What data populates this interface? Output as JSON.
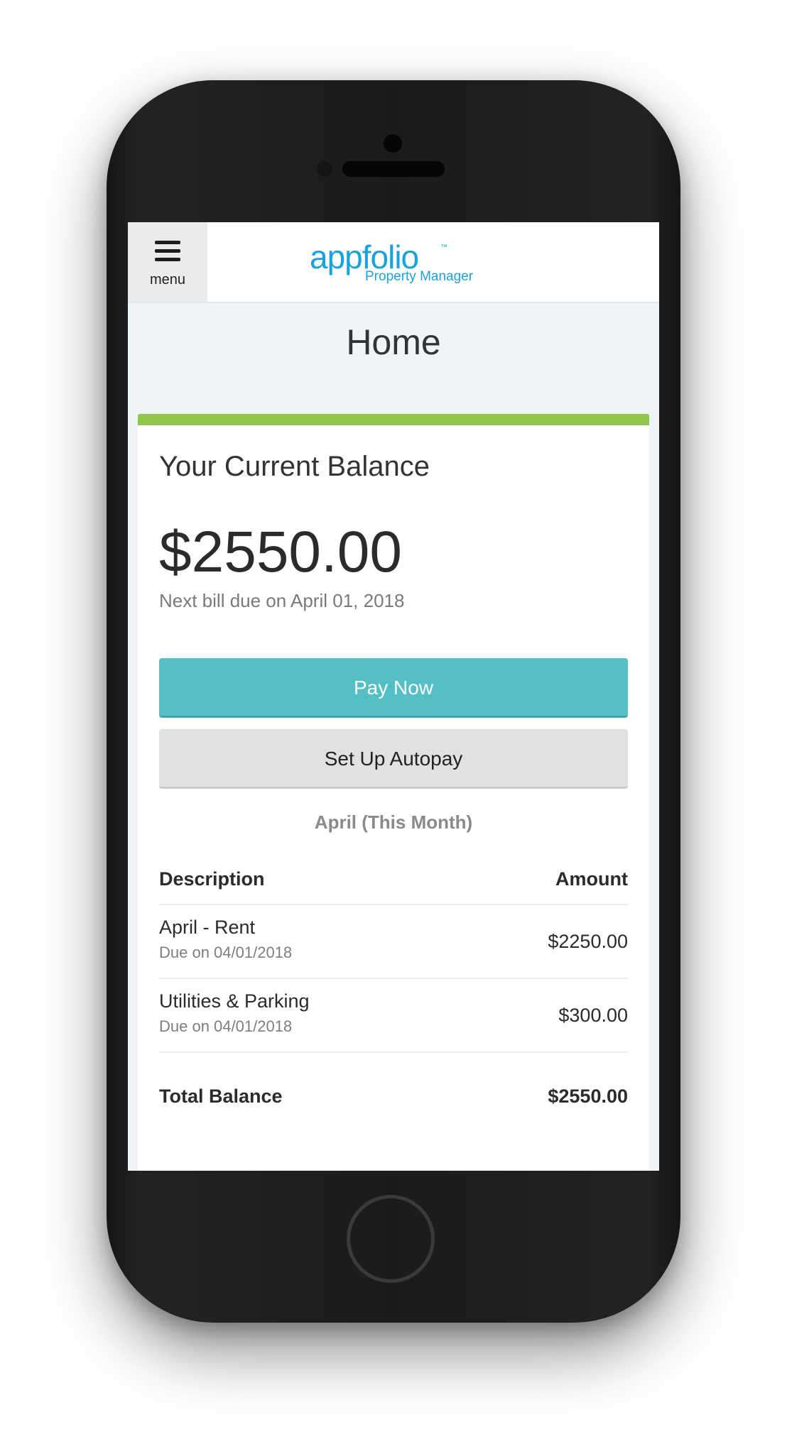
{
  "header": {
    "menu_label": "menu",
    "logo_text": "appfolio",
    "logo_tm": "™",
    "logo_subtitle": "Property Manager"
  },
  "page": {
    "title": "Home"
  },
  "balance": {
    "label": "Your Current Balance",
    "amount": "$2550.00",
    "next_bill": "Next bill due on April 01, 2018",
    "pay_now_label": "Pay Now",
    "autopay_label": "Set Up Autopay"
  },
  "statement": {
    "period_label": "April (This Month)",
    "columns": [
      "Description",
      "Amount"
    ],
    "items": [
      {
        "description": "April - Rent",
        "due": "Due on 04/01/2018",
        "amount": "$2250.00"
      },
      {
        "description": "Utilities & Parking",
        "due": "Due on 04/01/2018",
        "amount": "$300.00"
      }
    ],
    "total_label": "Total Balance",
    "total_amount": "$2550.00"
  },
  "colors": {
    "accent_green": "#8fc74a",
    "pay_button": "#54bfc4",
    "brand_blue": "#1aa2dd"
  }
}
